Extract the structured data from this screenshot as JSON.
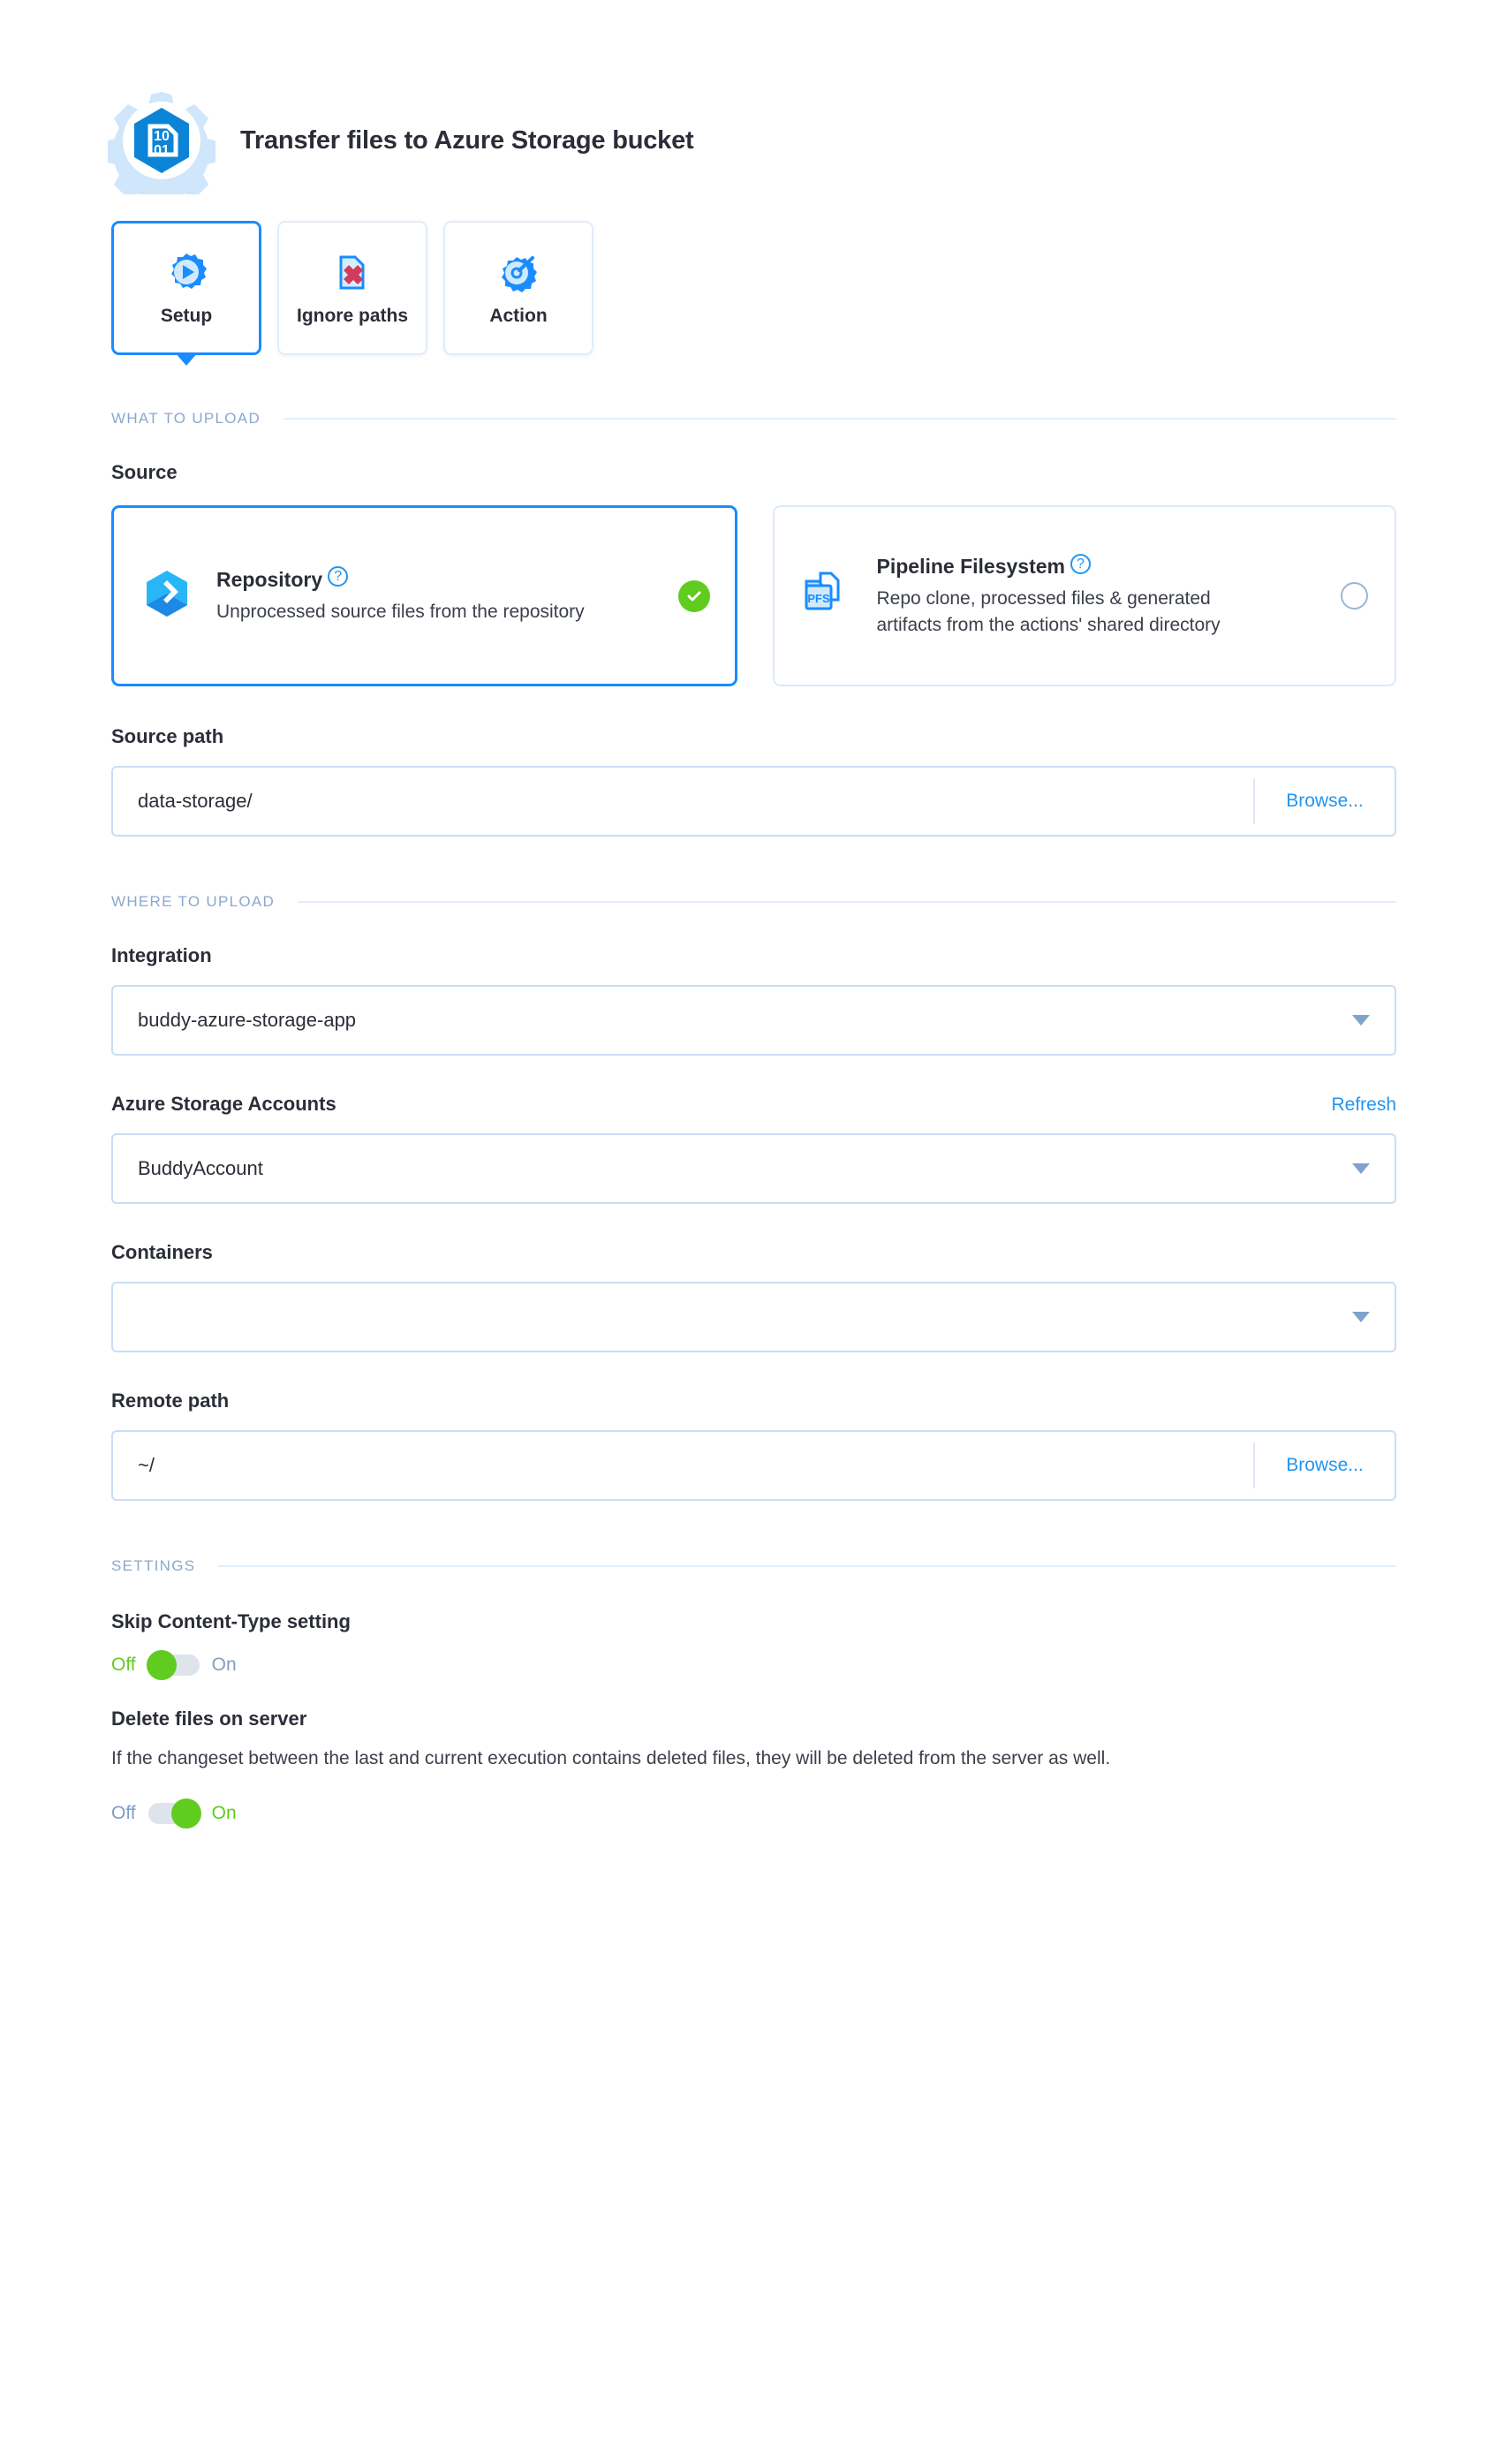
{
  "header": {
    "title": "Transfer files to Azure Storage bucket",
    "icon": "binary-gear-icon"
  },
  "tabs": [
    {
      "label": "Setup",
      "icon": "play-gear-icon",
      "active": true
    },
    {
      "label": "Ignore paths",
      "icon": "file-remove-icon",
      "active": false
    },
    {
      "label": "Action",
      "icon": "gear-wrench-icon",
      "active": false
    }
  ],
  "sections": {
    "what_to_upload": "WHAT TO UPLOAD",
    "where_to_upload": "WHERE TO UPLOAD",
    "settings": "SETTINGS"
  },
  "source": {
    "label": "Source",
    "options": [
      {
        "title": "Repository",
        "description": "Unprocessed source files from the repository",
        "icon": "repository-cube-icon",
        "selected": true,
        "help": "?"
      },
      {
        "title": "Pipeline Filesystem",
        "description": "Repo clone, processed files & generated artifacts from the actions' shared directory",
        "icon": "pfs-folder-icon",
        "selected": false,
        "help": "?"
      }
    ]
  },
  "source_path": {
    "label": "Source path",
    "value": "data-storage/",
    "placeholder": "",
    "browse_label": "Browse..."
  },
  "integration": {
    "label": "Integration",
    "value": "buddy-azure-storage-app"
  },
  "storage_accounts": {
    "label": "Azure Storage Accounts",
    "refresh_label": "Refresh",
    "value": "BuddyAccount"
  },
  "containers": {
    "label": "Containers",
    "value": ""
  },
  "remote_path": {
    "label": "Remote path",
    "value": "~/",
    "placeholder": "",
    "browse_label": "Browse..."
  },
  "skip_content_type": {
    "label": "Skip Content-Type setting",
    "off_label": "Off",
    "on_label": "On",
    "state": "off"
  },
  "delete_files": {
    "label": "Delete files on server",
    "description": "If the changeset between the last and current execution contains deleted files, they will be deleted from the server as well.",
    "off_label": "Off",
    "on_label": "On",
    "state": "on"
  },
  "colors": {
    "accent_blue": "#1a8cff",
    "link_blue": "#2196f3",
    "green": "#5fcc1f",
    "section_label": "#8aa8cc",
    "text_dark": "#2b2e38",
    "border_light": "#c9ddf5"
  }
}
